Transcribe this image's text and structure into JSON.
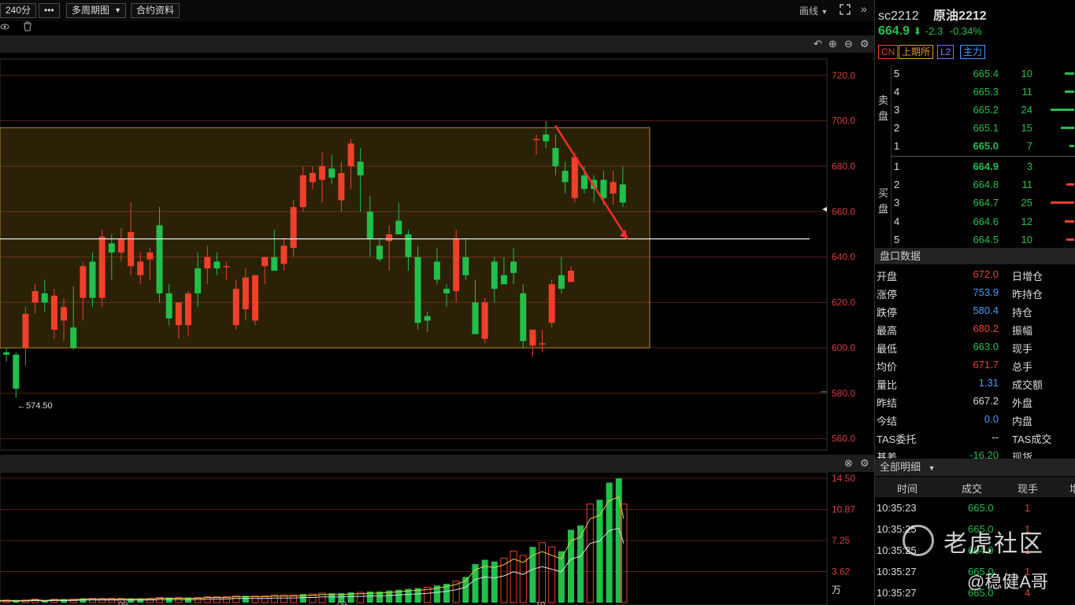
{
  "toolbar": {
    "period": "240分",
    "more": "•••",
    "multi_period": "多周期图",
    "contract_info": "合约资料",
    "draw_line": "画线",
    "expand": "»"
  },
  "chart": {
    "low_marker": "←574.50",
    "price_ticks": [
      "720.0",
      "700.0",
      "680.0",
      "660.0",
      "640.0",
      "620.0",
      "600.0",
      "580.0",
      "560.0"
    ],
    "vol_ticks": [
      "14.50",
      "10.87",
      "7.25",
      "3.62",
      "万"
    ],
    "x_labels": [
      "09",
      "09",
      "10"
    ],
    "colors": {
      "up": "#f0402a",
      "down": "#21c04a",
      "box": "#b08a20"
    }
  },
  "chart_data": [
    {
      "type": "candlestick",
      "ylim": [
        555,
        730
      ],
      "y_ticks": [
        720,
        700,
        680,
        660,
        640,
        620,
        600,
        580,
        560
      ],
      "annotations": [
        "←574.50"
      ],
      "candles": [
        {
          "o": 608,
          "h": 612,
          "l": 600,
          "c": 600
        },
        {
          "o": 598,
          "h": 600,
          "l": 594,
          "c": 597
        },
        {
          "o": 597,
          "h": 598,
          "l": 578,
          "c": 582
        },
        {
          "o": 600,
          "h": 618,
          "l": 592,
          "c": 615
        },
        {
          "o": 620,
          "h": 628,
          "l": 615,
          "c": 625
        },
        {
          "o": 624,
          "h": 630,
          "l": 616,
          "c": 620
        },
        {
          "o": 608,
          "h": 626,
          "l": 604,
          "c": 623
        },
        {
          "o": 612,
          "h": 622,
          "l": 603,
          "c": 618
        },
        {
          "o": 609,
          "h": 627,
          "l": 599,
          "c": 600
        },
        {
          "o": 622,
          "h": 638,
          "l": 612,
          "c": 636
        },
        {
          "o": 638,
          "h": 642,
          "l": 618,
          "c": 622
        },
        {
          "o": 622,
          "h": 652,
          "l": 618,
          "c": 649
        },
        {
          "o": 646,
          "h": 650,
          "l": 630,
          "c": 642
        },
        {
          "o": 642,
          "h": 653,
          "l": 638,
          "c": 648
        },
        {
          "o": 636,
          "h": 664,
          "l": 632,
          "c": 651
        },
        {
          "o": 632,
          "h": 642,
          "l": 628,
          "c": 638
        },
        {
          "o": 639,
          "h": 644,
          "l": 630,
          "c": 642
        },
        {
          "o": 654,
          "h": 662,
          "l": 620,
          "c": 624
        },
        {
          "o": 624,
          "h": 628,
          "l": 610,
          "c": 613
        },
        {
          "o": 610,
          "h": 618,
          "l": 604,
          "c": 620
        },
        {
          "o": 610,
          "h": 625,
          "l": 605,
          "c": 624
        },
        {
          "o": 635,
          "h": 642,
          "l": 618,
          "c": 624
        },
        {
          "o": 635,
          "h": 645,
          "l": 628,
          "c": 640
        },
        {
          "o": 638,
          "h": 642,
          "l": 632,
          "c": 635
        },
        {
          "o": 636,
          "h": 638,
          "l": 630,
          "c": 636
        },
        {
          "o": 610,
          "h": 630,
          "l": 608,
          "c": 626
        },
        {
          "o": 617,
          "h": 635,
          "l": 612,
          "c": 631
        },
        {
          "o": 612,
          "h": 632,
          "l": 610,
          "c": 632
        },
        {
          "o": 636,
          "h": 640,
          "l": 628,
          "c": 640
        },
        {
          "o": 640,
          "h": 652,
          "l": 636,
          "c": 634
        },
        {
          "o": 637,
          "h": 648,
          "l": 634,
          "c": 645
        },
        {
          "o": 644,
          "h": 665,
          "l": 640,
          "c": 662
        },
        {
          "o": 662,
          "h": 680,
          "l": 660,
          "c": 676
        },
        {
          "o": 673,
          "h": 680,
          "l": 670,
          "c": 677
        },
        {
          "o": 674,
          "h": 686,
          "l": 664,
          "c": 680
        },
        {
          "o": 679,
          "h": 685,
          "l": 672,
          "c": 675
        },
        {
          "o": 665,
          "h": 682,
          "l": 660,
          "c": 677
        },
        {
          "o": 680,
          "h": 692,
          "l": 670,
          "c": 690
        },
        {
          "o": 682,
          "h": 688,
          "l": 660,
          "c": 676
        },
        {
          "o": 660,
          "h": 667,
          "l": 640,
          "c": 648
        },
        {
          "o": 645,
          "h": 648,
          "l": 638,
          "c": 639
        },
        {
          "o": 647,
          "h": 654,
          "l": 634,
          "c": 650
        },
        {
          "o": 656,
          "h": 664,
          "l": 650,
          "c": 650
        },
        {
          "o": 650,
          "h": 652,
          "l": 634,
          "c": 640
        },
        {
          "o": 640,
          "h": 645,
          "l": 608,
          "c": 611
        },
        {
          "o": 614,
          "h": 616,
          "l": 607,
          "c": 612
        },
        {
          "o": 638,
          "h": 644,
          "l": 628,
          "c": 630
        },
        {
          "o": 626,
          "h": 628,
          "l": 618,
          "c": 624
        },
        {
          "o": 625,
          "h": 652,
          "l": 620,
          "c": 648
        },
        {
          "o": 640,
          "h": 648,
          "l": 630,
          "c": 632
        },
        {
          "o": 620,
          "h": 630,
          "l": 610,
          "c": 606
        },
        {
          "o": 604,
          "h": 622,
          "l": 602,
          "c": 620
        },
        {
          "o": 638,
          "h": 640,
          "l": 620,
          "c": 626
        },
        {
          "o": 632,
          "h": 640,
          "l": 628,
          "c": 628
        },
        {
          "o": 638,
          "h": 644,
          "l": 628,
          "c": 633
        },
        {
          "o": 624,
          "h": 628,
          "l": 600,
          "c": 603
        },
        {
          "o": 601,
          "h": 607,
          "l": 596,
          "c": 608
        },
        {
          "o": 602,
          "h": 608,
          "l": 598,
          "c": 602
        },
        {
          "o": 611,
          "h": 630,
          "l": 609,
          "c": 628
        },
        {
          "o": 632,
          "h": 640,
          "l": 624,
          "c": 626
        },
        {
          "o": 629,
          "h": 636,
          "l": 630,
          "c": 634
        },
        {
          "o": 692,
          "h": 694,
          "l": 685,
          "c": 692
        },
        {
          "o": 694,
          "h": 700,
          "l": 688,
          "c": 691
        },
        {
          "o": 688,
          "h": 694,
          "l": 676,
          "c": 680
        },
        {
          "o": 678,
          "h": 682,
          "l": 668,
          "c": 673
        },
        {
          "o": 666,
          "h": 686,
          "l": 664,
          "c": 684
        },
        {
          "o": 676,
          "h": 680,
          "l": 668,
          "c": 670
        },
        {
          "o": 674,
          "h": 676,
          "l": 664,
          "c": 670
        },
        {
          "o": 674,
          "h": 678,
          "l": 663,
          "c": 666
        },
        {
          "o": 668,
          "h": 678,
          "l": 663,
          "c": 673
        },
        {
          "o": 672,
          "h": 680,
          "l": 662,
          "c": 664
        }
      ],
      "reference_line": 648,
      "range_box": [
        600,
        697
      ],
      "arrow": {
        "from": 698,
        "to": 648
      }
    },
    {
      "type": "bar",
      "ylim": [
        0,
        14.5
      ],
      "y_ticks": [
        14.5,
        10.87,
        7.25,
        3.62
      ],
      "values": [
        0.3,
        0.3,
        0.3,
        0.3,
        0.4,
        0.3,
        0.4,
        0.4,
        0.4,
        0.5,
        0.5,
        0.5,
        0.5,
        0.5,
        0.5,
        0.5,
        0.5,
        0.6,
        0.6,
        0.6,
        0.6,
        0.6,
        0.7,
        0.7,
        0.7,
        0.8,
        0.8,
        0.8,
        0.8,
        0.9,
        0.9,
        0.9,
        1.0,
        1.0,
        1.1,
        1.1,
        1.1,
        1.2,
        1.2,
        1.3,
        1.3,
        1.4,
        1.5,
        1.6,
        1.7,
        1.8,
        2.0,
        2.2,
        2.5,
        3.0,
        4.5,
        5.0,
        4.8,
        5.2,
        6.0,
        5.5,
        6.5,
        7.0,
        6.5,
        6.0,
        8.5,
        9.0,
        11.5,
        12.0,
        14.0,
        14.5,
        11.5
      ]
    }
  ],
  "side": {
    "symbol": "sc2212",
    "name": "原油2212",
    "price": "664.9",
    "arrow": "⬇",
    "change": "-2.3",
    "change_pct": "-0.34%",
    "tags": [
      "CN",
      "上期所",
      "L2",
      "主力"
    ],
    "sell_label": "卖盘",
    "buy_label": "买盘",
    "asks": [
      {
        "lv": "5",
        "p": "665.4",
        "v": "10",
        "w": 12
      },
      {
        "lv": "4",
        "p": "665.3",
        "v": "11",
        "w": 12
      },
      {
        "lv": "3",
        "p": "665.2",
        "v": "24",
        "w": 30
      },
      {
        "lv": "2",
        "p": "665.1",
        "v": "15",
        "w": 17
      },
      {
        "lv": "1",
        "p": "665.0",
        "v": "7",
        "w": 6
      }
    ],
    "bids": [
      {
        "lv": "1",
        "p": "664.9",
        "v": "3",
        "w": 0
      },
      {
        "lv": "2",
        "p": "664.8",
        "v": "11",
        "w": 10
      },
      {
        "lv": "3",
        "p": "664.7",
        "v": "25",
        "w": 30
      },
      {
        "lv": "4",
        "p": "664.6",
        "v": "12",
        "w": 12
      },
      {
        "lv": "5",
        "p": "664.5",
        "v": "10",
        "w": 10
      }
    ],
    "panel_title": "盘口数据",
    "stats": [
      {
        "l": "开盘",
        "v": "672.0",
        "c": "#f0402a",
        "r": "日增仓"
      },
      {
        "l": "涨停",
        "v": "753.9",
        "c": "#4a9cff",
        "r": "昨持仓"
      },
      {
        "l": "跌停",
        "v": "580.4",
        "c": "#4a9cff",
        "r": "持仓"
      },
      {
        "l": "最高",
        "v": "680.2",
        "c": "#f0402a",
        "r": "振幅"
      },
      {
        "l": "最低",
        "v": "663.0",
        "c": "#21c04a",
        "r": "现手"
      },
      {
        "l": "均价",
        "v": "671.7",
        "c": "#f0402a",
        "r": "总手"
      },
      {
        "l": "量比",
        "v": "1.31",
        "c": "#4a9cff",
        "r": "成交额"
      },
      {
        "l": "昨结",
        "v": "667.2",
        "c": "#ddd",
        "r": "外盘"
      },
      {
        "l": "今结",
        "v": "0.0",
        "c": "#4a9cff",
        "r": "内盘"
      },
      {
        "l": "TAS委托",
        "v": "--",
        "c": "#ddd",
        "r": "TAS成交"
      },
      {
        "l": "基差",
        "v": "-16.20",
        "c": "#21c04a",
        "r": "现货"
      }
    ],
    "detail_title": "全部明细",
    "detail_cols": [
      "时间",
      "成交",
      "现手",
      "增"
    ],
    "details": [
      {
        "t": "10:35:23",
        "p": "665.0",
        "q": "1"
      },
      {
        "t": "10:35:25",
        "p": "665.0",
        "q": "1"
      },
      {
        "t": "10:35:25",
        "p": "664.9",
        "q": "1"
      },
      {
        "t": "10:35:27",
        "p": "665.0",
        "q": "1"
      },
      {
        "t": "10:35:27",
        "p": "665.0",
        "q": "4"
      }
    ]
  },
  "watermark": {
    "brand": "老虎社区",
    "author": "@稳健A哥"
  }
}
